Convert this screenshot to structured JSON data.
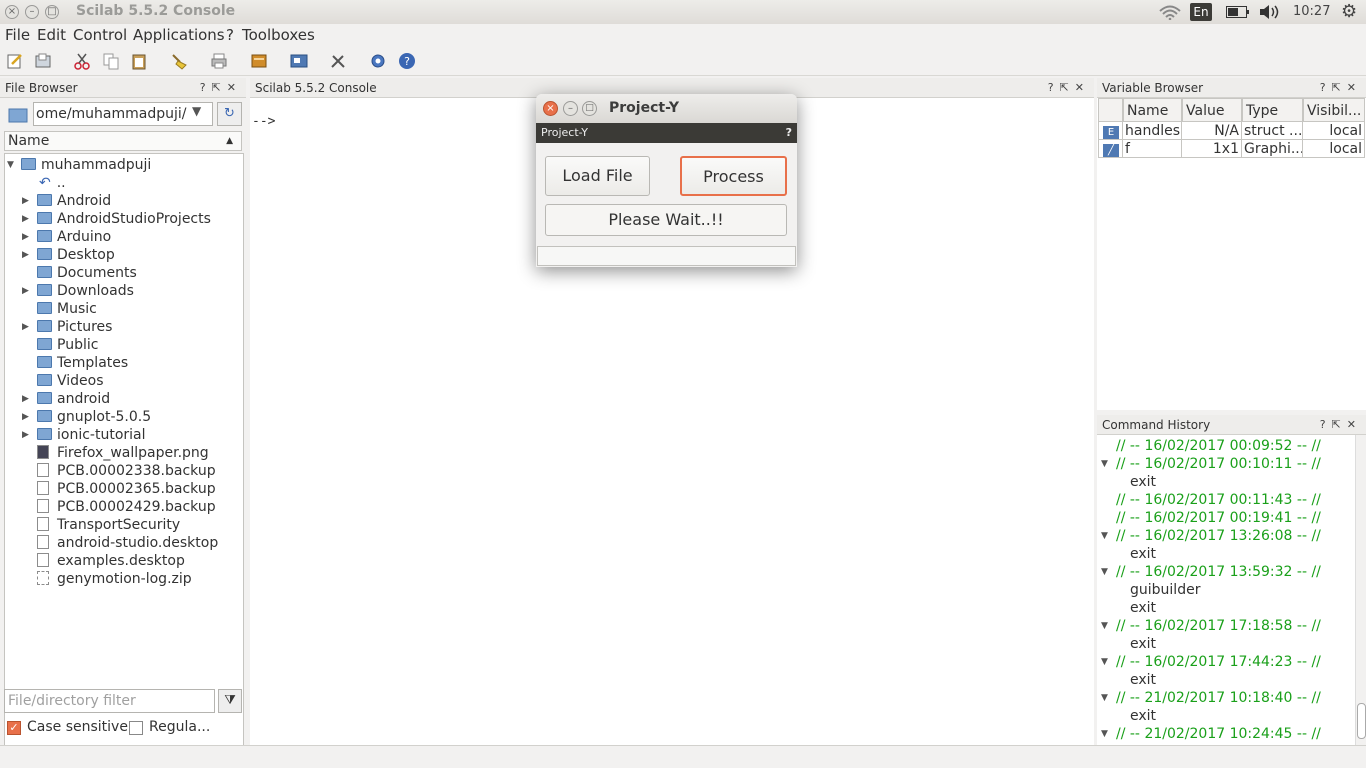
{
  "window": {
    "title": "Scilab 5.5.2 Console"
  },
  "tray": {
    "lang": "En",
    "time": "10:27"
  },
  "menu": [
    "File",
    "Edit",
    "Control",
    "Applications",
    "?",
    "Toolboxes"
  ],
  "file_browser": {
    "title": "File Browser",
    "path": "ome/muhammadpuji/",
    "name_header": "Name",
    "root": "muhammadpuji",
    "parent": "..",
    "items": [
      {
        "name": "Android",
        "type": "folder",
        "expand": true
      },
      {
        "name": "AndroidStudioProjects",
        "type": "folder",
        "expand": true
      },
      {
        "name": "Arduino",
        "type": "folder",
        "expand": true
      },
      {
        "name": "Desktop",
        "type": "folder",
        "expand": true
      },
      {
        "name": "Documents",
        "type": "folder",
        "expand": false
      },
      {
        "name": "Downloads",
        "type": "folder",
        "expand": true
      },
      {
        "name": "Music",
        "type": "folder",
        "expand": false
      },
      {
        "name": "Pictures",
        "type": "folder",
        "expand": true
      },
      {
        "name": "Public",
        "type": "folder",
        "expand": false
      },
      {
        "name": "Templates",
        "type": "folder",
        "expand": false
      },
      {
        "name": "Videos",
        "type": "folder",
        "expand": false
      },
      {
        "name": "android",
        "type": "folder",
        "expand": true
      },
      {
        "name": "gnuplot-5.0.5",
        "type": "folder",
        "expand": true
      },
      {
        "name": "ionic-tutorial",
        "type": "folder",
        "expand": true
      },
      {
        "name": "Firefox_wallpaper.png",
        "type": "image",
        "expand": false
      },
      {
        "name": "PCB.00002338.backup",
        "type": "file",
        "expand": false
      },
      {
        "name": "PCB.00002365.backup",
        "type": "file",
        "expand": false
      },
      {
        "name": "PCB.00002429.backup",
        "type": "file",
        "expand": false
      },
      {
        "name": "TransportSecurity",
        "type": "file",
        "expand": false
      },
      {
        "name": "android-studio.desktop",
        "type": "file",
        "expand": false
      },
      {
        "name": "examples.desktop",
        "type": "file",
        "expand": false
      },
      {
        "name": "genymotion-log.zip",
        "type": "zip",
        "expand": false
      }
    ],
    "filter_placeholder": "File/directory filter",
    "case_sensitive": "Case sensitive",
    "regular": "Regula..."
  },
  "console": {
    "title": "Scilab 5.5.2 Console",
    "prompt": "-->"
  },
  "variable_browser": {
    "title": "Variable Browser",
    "columns": [
      "Name",
      "Value",
      "Type",
      "Visibil..."
    ],
    "rows": [
      {
        "name": "handles",
        "value": "N/A",
        "type": "struct ...",
        "vis": "local"
      },
      {
        "name": "f",
        "value": "1x1",
        "type": "Graphi...",
        "vis": "local"
      }
    ]
  },
  "command_history": {
    "title": "Command History",
    "entries": [
      {
        "ts": "// -- 16/02/2017 00:09:52 -- //",
        "arrow": false,
        "cmds": []
      },
      {
        "ts": "// -- 16/02/2017 00:10:11 -- //",
        "arrow": true,
        "cmds": [
          "exit"
        ]
      },
      {
        "ts": "// -- 16/02/2017 00:11:43 -- //",
        "arrow": false,
        "cmds": []
      },
      {
        "ts": "// -- 16/02/2017 00:19:41 -- //",
        "arrow": false,
        "cmds": []
      },
      {
        "ts": "// -- 16/02/2017 13:26:08 -- //",
        "arrow": true,
        "cmds": [
          "exit"
        ]
      },
      {
        "ts": "// -- 16/02/2017 13:59:32 -- //",
        "arrow": true,
        "cmds": [
          "guibuilder",
          "exit"
        ]
      },
      {
        "ts": "// -- 16/02/2017 17:18:58 -- //",
        "arrow": true,
        "cmds": [
          "exit"
        ]
      },
      {
        "ts": "// -- 16/02/2017 17:44:23 -- //",
        "arrow": true,
        "cmds": [
          "exit"
        ]
      },
      {
        "ts": "// -- 21/02/2017 10:18:40 -- //",
        "arrow": true,
        "cmds": [
          "exit"
        ]
      },
      {
        "ts": "// -- 21/02/2017 10:24:45 -- //",
        "arrow": true,
        "cmds": []
      }
    ]
  },
  "dialog": {
    "title": "Project-Y",
    "subtitle": "Project-Y",
    "help": "?",
    "load_label": "Load File",
    "process_label": "Process",
    "status": "Please Wait..!!"
  },
  "colors": {
    "accent": "#e8704a",
    "history_ts": "#1aa01a"
  }
}
